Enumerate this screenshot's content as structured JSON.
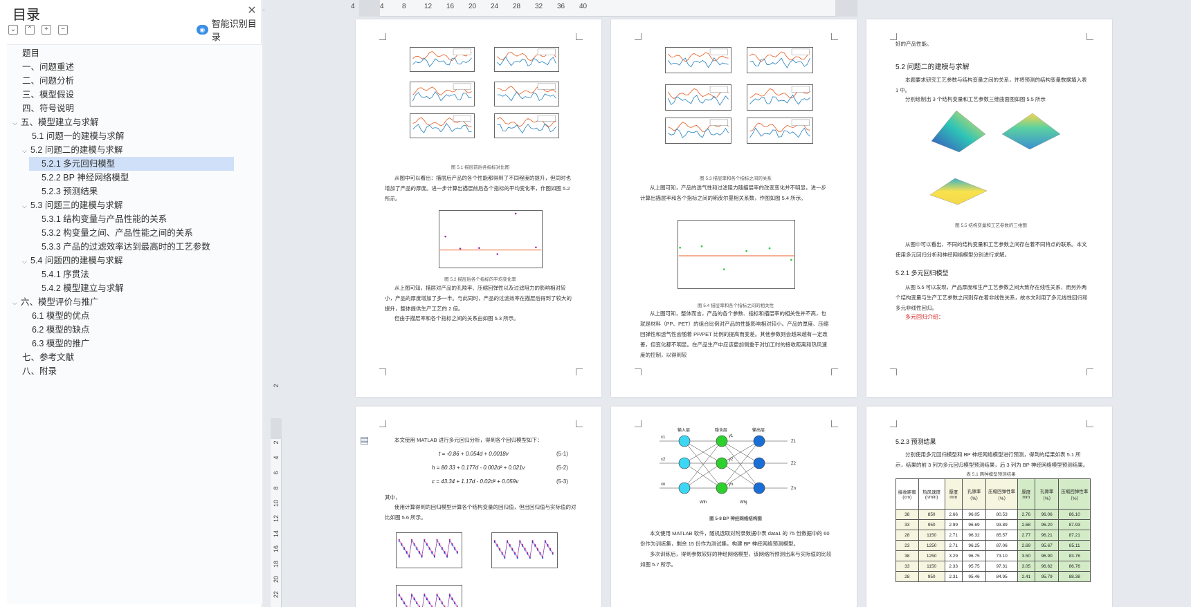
{
  "sidebar": {
    "title": "目录",
    "smart_toc_label": "智能识别目录",
    "toc": [
      {
        "label": "题目",
        "level": 0,
        "caret": ""
      },
      {
        "label": "一、问题重述",
        "level": 1,
        "caret": ""
      },
      {
        "label": "二、问题分析",
        "level": 1,
        "caret": ""
      },
      {
        "label": "三、模型假设",
        "level": 1,
        "caret": ""
      },
      {
        "label": "四、符号说明",
        "level": 1,
        "caret": ""
      },
      {
        "label": "五、模型建立与求解",
        "level": 1,
        "caret": "v"
      },
      {
        "label": "5.1 问题一的建模与求解",
        "level": 2,
        "caret": ""
      },
      {
        "label": "5.2 问题二的建模与求解",
        "level": 2,
        "caret": "v"
      },
      {
        "label": "5.2.1 多元回归模型",
        "level": 3,
        "caret": "",
        "selected": true
      },
      {
        "label": "5.2.2 BP 神经网络模型",
        "level": 3,
        "caret": ""
      },
      {
        "label": "5.2.3 预测结果",
        "level": 3,
        "caret": ""
      },
      {
        "label": "5.3 问题三的建模与求解",
        "level": 2,
        "caret": "v"
      },
      {
        "label": "5.3.1 结构变量与产品性能的关系",
        "level": 3,
        "caret": ""
      },
      {
        "label": "5.3.2 构变量之间、产品性能之间的关系",
        "level": 3,
        "caret": ""
      },
      {
        "label": "5.3.3 产品的过滤效率达到最高时的工艺参数",
        "level": 3,
        "caret": ""
      },
      {
        "label": "5.4 问题四的建模与求解",
        "level": 2,
        "caret": "v"
      },
      {
        "label": "5.4.1 序贯法",
        "level": 3,
        "caret": ""
      },
      {
        "label": "5.4.2 模型建立与求解",
        "level": 3,
        "caret": ""
      },
      {
        "label": "六、模型评价与推广",
        "level": 1,
        "caret": "v"
      },
      {
        "label": "6.1 模型的优点",
        "level": 2,
        "caret": ""
      },
      {
        "label": "6.2 模型的缺点",
        "level": 2,
        "caret": ""
      },
      {
        "label": "6.3 模型的推广",
        "level": 2,
        "caret": ""
      },
      {
        "label": "七、参考文献",
        "level": 1,
        "caret": ""
      },
      {
        "label": "八、附录",
        "level": 1,
        "caret": ""
      }
    ]
  },
  "ruler": {
    "ticks": [
      "4",
      "4",
      "8",
      "12",
      "16",
      "20",
      "24",
      "28",
      "32",
      "36",
      "40"
    ],
    "vticks": [
      "2",
      "2",
      "4",
      "6",
      "8",
      "10",
      "12",
      "14",
      "16",
      "18",
      "20",
      "22"
    ]
  },
  "pages": {
    "p1": {
      "caption1": "图 5.1 描层前后各指标对比图",
      "para1": "从图中可以看出：描层后产品的各个性能都得到了不同程度的提升，但同时也增加了产品的厚度。进一步计算出描层前后各个指标的平均变化率，作图如图 5.2 所示。",
      "caption2": "图 5.2 描层后各个指标的平均变化率",
      "para2": "从上图可知，描层对产品的孔隙率、压缩回弹性以及过滤阻力的影响相对较小，产品的厚度增加了多一半。与此同时，产品的过滤效率在描层后得到了较大的提升，整体提供生产工艺的 2 倍。",
      "para3": "但由于描层率和各个指标之间的关系由如图 5.3 所示。"
    },
    "p2": {
      "caption1": "图 5.3 描层率和各个指标之间的关系",
      "para1": "从上图可知，产品的透气性和过滤阻力随描层率的改变变化并不明显，进一步计算出描层率和各个指标之间的斯皮尔曼相关系数，作图如图 5.4 所示。",
      "caption2": "图 5.4 描层率和各个指标之间的相关性",
      "para2": "从上图可知，整体而言，产品的各个参数、指标和描层率的相关性并不高，也就是材料（PP、PET）的组合比例对产品的性能影响相对较小。产品的厚度、压缩回弹性和透气性会随着 PP/PET 比例的提高而变差。其他参数则会越来越有一定改善，但变化都不明显。在产品生产中应该更加侧重于对加工时的接收距离和热风速度的控制，以得到较"
    },
    "p3": {
      "top_text": "好的产品性能。",
      "heading1": "5.2 问题二的建模与求解",
      "para1": "本题要求研究工艺参数与结构变量之间的关系，并将预测的结构变量数据填入表 1 中。",
      "para2": "分别绘制出 3 个结构变量和工艺参数三维曲面图如图 5.5 所示",
      "caption1": "图 5.5 结构变量和工艺参数的三维图",
      "para3": "从图中可以看出，不同的结构变量和工艺参数之间存在着不同特点的联系。本文使用多元回归分析和神经网络模型分别进行求解。",
      "heading2": "5.2.1 多元回归模型",
      "para4": "从图 5.5 可以发现，产品厚度和生产工艺参数之间大致存在线性关系，而另外两个结构变量与生产工艺参数之间则存在着非线性关系，故本文利用了多元线性回归和多元非线性回归。",
      "red_note": "多元回归介绍："
    },
    "p4": {
      "para1": "本文使用 MATLAB 进行多元回归分析，得到各个回归模型如下：",
      "eq1": "t = -0.86 + 0.054d + 0.0018v",
      "eq1_num": "(5-1)",
      "eq2": "h = 80.33 + 0.177d - 0.002d² + 0.021v",
      "eq2_num": "(5-2)",
      "eq3": "c = 43.34 + 1.17d - 0.02d² + 0.059v",
      "eq3_num": "(5-3)",
      "para2": "其中，",
      "para3": "使用计算得到的回归模型计算各个结构变量的回归值，但出回归值与实际值的对比如图 5.6 所示。"
    },
    "p5": {
      "labels": {
        "input": "输入层",
        "hidden": "隐含层",
        "output": "输出层",
        "x1": "x1",
        "x2": "x2",
        "xn": "xn",
        "y1": "y1",
        "y2": "y2",
        "yn": "yn",
        "z1": "Z1",
        "z2": "Z2",
        "zn": "Zn",
        "wih": "Wih",
        "whj": "Whj"
      },
      "caption1": "图 5-8 BP 神经网络结构图",
      "para1": "本文使用 MATLAB 软件，随机选取对附录数据中表 data1 的 75 份数据中的 60 份作为训练集，剩余 15 份作为测试集，构建 BP 神经网络预测模型。",
      "para2": "多次训练后，得到参数较好的神经网络模型，该网络所预测出来与实际值的比较如图 5.7 所示。"
    },
    "p6": {
      "heading1": "5.2.3 预测结果",
      "para1": "分别使用多元回归模型和 BP 神经网络模型进行预测，得到的结果如表 5.1 所示，结果的前 3 列为多元回归模型预测结果，后 3 列为 BP 神经网络模型预测结果。",
      "caption1": "表 5.1 两种模型预测结果",
      "table_headers": [
        "接收距离(cm)",
        "热风速度(r/min)",
        "厚度 mm",
        "孔隙率（%）",
        "压缩回弹性率（%）",
        "厚度 mm",
        "孔隙率（%）",
        "压缩回弹性率（%）"
      ],
      "table_rows": [
        [
          "38",
          "850",
          "2.66",
          "96.05",
          "80.53",
          "2.76",
          "96.06",
          "86.10"
        ],
        [
          "33",
          "950",
          "2.99",
          "96.69",
          "93.89",
          "2.68",
          "96.20",
          "87.93"
        ],
        [
          "28",
          "1150",
          "2.71",
          "96.32",
          "85.57",
          "2.77",
          "96.21",
          "87.21"
        ],
        [
          "23",
          "1250",
          "2.71",
          "96.25",
          "87.06",
          "2.69",
          "95.67",
          "85.11"
        ],
        [
          "38",
          "1250",
          "3.29",
          "96.75",
          "73.10",
          "3.50",
          "96.90",
          "83.76"
        ],
        [
          "33",
          "1150",
          "2.33",
          "95.75",
          "97.31",
          "3.05",
          "96.62",
          "86.76"
        ],
        [
          "28",
          "950",
          "2.31",
          "95.46",
          "84.95",
          "2.41",
          "95.79",
          "88.38"
        ]
      ]
    }
  },
  "colors": {
    "accent": "#3a8ee6",
    "selected_bg": "#cfe0f8",
    "series_orange": "#e8622a",
    "series_blue": "#2e86c1",
    "red_note": "#d32020"
  }
}
